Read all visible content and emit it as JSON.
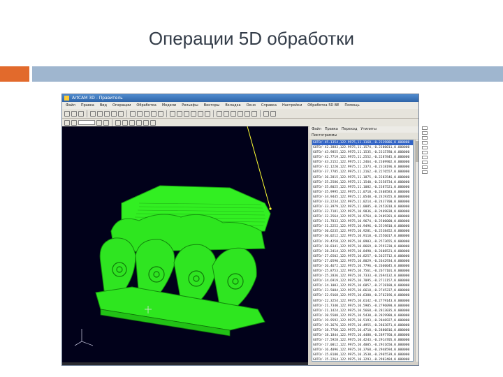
{
  "slide": {
    "title": "Операции 5D обработки"
  },
  "window": {
    "title": "ArtCAM 3D - Правитель"
  },
  "menu": [
    "Файл",
    "Правка",
    "Вид",
    "Операции",
    "Обработка",
    "Модели",
    "Рельефы",
    "Векторы",
    "Вкладка",
    "Окно",
    "Справка",
    "Настройки",
    "Обработка 5D ВЕ",
    "Помощь"
  ],
  "gcode_panel": {
    "menu": [
      "Файл",
      "Правка",
      "Переход",
      "Утилиты"
    ],
    "toolbar_label": "Пиктограммы",
    "lines": [
      "GOTO/-45.1354,122.9975,11.1168,-0.2339886,0.000000",
      "GOTO/-42.3883,122.9975,11.1574,-0.2300011,0.000000",
      "GOTO/-43.9855,122.9975,11.1535,-0.2315780,0.000000",
      "GOTO/-42.7719,122.9975,11.2552,-0.2287845,0.000000",
      "GOTO/-43.2152,122.9975,11.2464,-0.2309902,0.000000",
      "GOTO/-42.1220,122.9975,11.2373,-0.2318196,0.000000",
      "GOTO/-37.7785,122.9975,11.2162,-0.2276557,0.000000",
      "GOTO/-36.2815,122.9975,11.1875,-0.2283546,0.000000",
      "GOTO/-35.2586,122.9975,11.1540,-0.2358734,0.000000",
      "GOTO/-35.8025,122.9975,11.1082,-0.2387521,0.000000",
      "GOTO/-35.9995,122.9975,11.0718,-0.2408583,0.000000",
      "GOTO/-34.9445,122.9975,11.0540,-0.2419355,0.000000",
      "GOTO/-33.2234,122.9975,11.0214,-0.2437700,0.000000",
      "GOTO/-33.3979,122.9975,11.0085,-0.2452018,0.000000",
      "GOTO/-32.7181,122.9975,10.9836,-0.2469838,0.000000",
      "GOTO/-32.2564,122.9975,10.9764,-0.2489201,0.000000",
      "GOTO/-31.7833,122.9975,10.9674,-0.2500000,0.000000",
      "GOTO/-31.2252,122.9975,10.9496,-0.2519810,0.000000",
      "GOTO/-30.6235,122.9975,10.9281,-0.2538452,0.000000",
      "GOTO/-30.0212,122.9975,10.9110,-0.2556017,0.000000",
      "GOTO/-29.4258,122.9975,10.8903,-0.2573655,0.000000",
      "GOTO/-28.8341,122.9975,10.8669,-0.2591230,0.000000",
      "GOTO/-28.2414,122.9975,10.8490,-0.2608521,0.000000",
      "GOTO/-27.6502,122.9975,10.8257,-0.2625712,0.000000",
      "GOTO/-27.0590,122.9975,10.8029,-0.2642934,0.000000",
      "GOTO/-26.4672,122.9975,10.7796,-0.2660045,0.000000",
      "GOTO/-25.8753,122.9975,10.7561,-0.2677101,0.000000",
      "GOTO/-25.2836,122.9975,10.7333,-0.2694132,0.000000",
      "GOTO/-24.6919,122.9975,10.7095,-0.2711157,0.000000",
      "GOTO/-24.1003,122.9975,10.6857,-0.2728180,0.000000",
      "GOTO/-23.5084,122.9975,10.6618,-0.2745237,0.000000",
      "GOTO/-22.9168,122.9975,10.6380,-0.2762196,0.000000",
      "GOTO/-22.3254,122.9975,10.6142,-0.2779143,0.000000",
      "GOTO/-21.7340,122.9975,10.5905,-0.2796090,0.000000",
      "GOTO/-21.1424,122.9975,10.5668,-0.2813035,0.000000",
      "GOTO/-20.5508,122.9975,10.5430,-0.2829980,0.000000",
      "GOTO/-19.9592,122.9975,10.5193,-0.2846927,0.000000",
      "GOTO/-19.3676,122.9975,10.4955,-0.2863871,0.000000",
      "GOTO/-18.7760,122.9975,10.4718,-0.2880816,0.000000",
      "GOTO/-18.1844,122.9975,10.4480,-0.2897760,0.000000",
      "GOTO/-17.5928,122.9975,10.4243,-0.2914705,0.000000",
      "GOTO/-17.0012,122.9975,10.4005,-0.2931650,0.000000",
      "GOTO/-16.4096,122.9975,10.3768,-0.2948594,0.000000",
      "GOTO/-15.8180,122.9975,10.3530,-0.2965539,0.000000",
      "GOTO/-15.2264,122.9975,10.3293,-0.2982484,0.000000"
    ]
  },
  "colors": {
    "viewport_bg": "#01011a",
    "model_green": "#2ee61f",
    "toolpath": "#ffff33",
    "accent_orange": "#e26a2c",
    "accent_blue": "#9fb6cf"
  }
}
